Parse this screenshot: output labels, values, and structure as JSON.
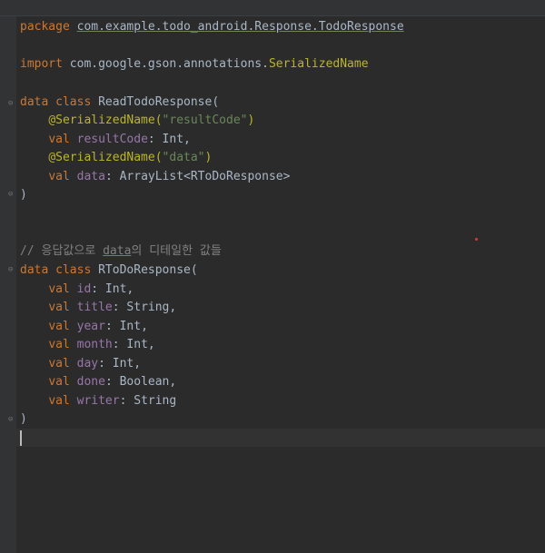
{
  "editor": {
    "line1": {
      "kw": "package",
      "text": "com.example.todo_android.Response.TodoResponse"
    },
    "line3": {
      "kw": "import",
      "text": "com.google.gson.annotations.",
      "name": "SerializedName"
    },
    "line5": {
      "kw": "data class",
      "text": "ReadTodoResponse("
    },
    "line6": {
      "ann": "@SerializedName(",
      "str": "\"resultCode\"",
      "close": ")"
    },
    "line7": {
      "kw": "val",
      "prop": "resultCode",
      "rest": ": Int,"
    },
    "line8": {
      "ann": "@SerializedName(",
      "str": "\"data\"",
      "close": ")"
    },
    "line9": {
      "kw": "val",
      "prop": "data",
      "rest": ": ArrayList<RToDoResponse>"
    },
    "line10": {
      "text": ")"
    },
    "line13": {
      "pre": "// 응답값으로 ",
      "under": "data",
      "post": "의 디테일한 값들"
    },
    "line14": {
      "kw": "data class",
      "text": "RToDoResponse("
    },
    "line15": {
      "kw": "val",
      "prop": "id",
      "rest": ": Int,"
    },
    "line16": {
      "kw": "val",
      "prop": "title",
      "rest": ": String,"
    },
    "line17": {
      "kw": "val",
      "prop": "year",
      "rest": ": Int,"
    },
    "line18": {
      "kw": "val",
      "prop": "month",
      "rest": ": Int,"
    },
    "line19": {
      "kw": "val",
      "prop": "day",
      "rest": ": Int,"
    },
    "line20": {
      "kw": "val",
      "prop": "done",
      "rest": ": Boolean,"
    },
    "line21": {
      "kw": "val",
      "prop": "writer",
      "rest": ": String"
    },
    "line22": {
      "text": ")"
    }
  },
  "icons": {
    "fold": "fold-marker-icon"
  },
  "colors": {
    "background": "#2b2b2b",
    "keyword": "#cc7832",
    "annotation": "#bbb529",
    "string": "#6a8759",
    "property": "#9876aa",
    "comment": "#808080",
    "text": "#a9b7c6"
  }
}
